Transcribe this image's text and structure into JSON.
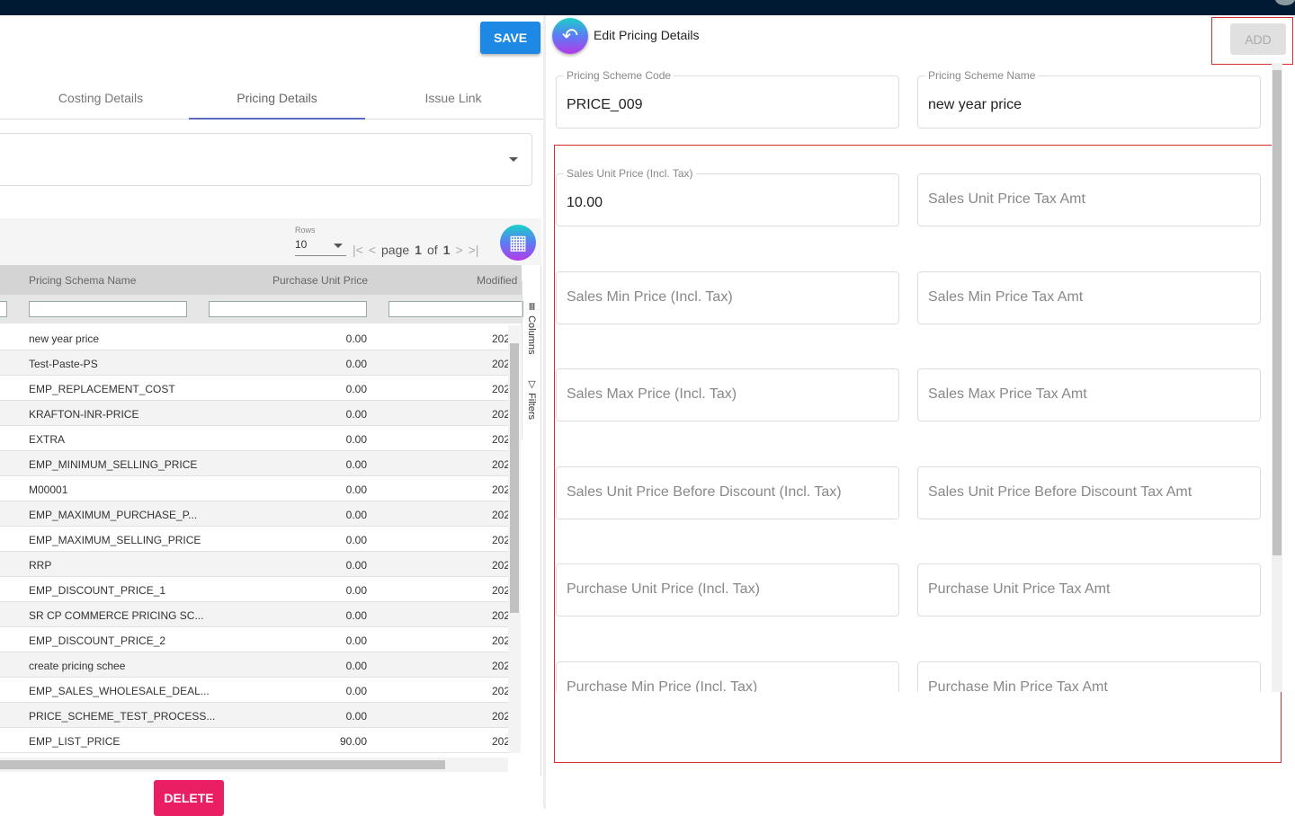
{
  "left": {
    "save_label": "SAVE",
    "delete_label": "DELETE",
    "tabs": [
      "Costing Details",
      "Pricing Details",
      "Issue Link"
    ],
    "pager": {
      "rows_label": "Rows",
      "rows_value": "10",
      "page_word": "page",
      "page": "1",
      "of_word": "of",
      "total": "1"
    },
    "columns": [
      "Pricing Schema Name",
      "Purchase Unit Price",
      "Modified"
    ],
    "side_tabs": [
      "Columns",
      "Filters"
    ],
    "rows": [
      [
        "new year price",
        "0.00",
        "202"
      ],
      [
        "Test-Paste-PS",
        "0.00",
        "202"
      ],
      [
        "EMP_REPLACEMENT_COST",
        "0.00",
        "202"
      ],
      [
        "KRAFTON-INR-PRICE",
        "0.00",
        "202"
      ],
      [
        "EXTRA",
        "0.00",
        "202"
      ],
      [
        "EMP_MINIMUM_SELLING_PRICE",
        "0.00",
        "202"
      ],
      [
        "M00001",
        "0.00",
        "202"
      ],
      [
        "EMP_MAXIMUM_PURCHASE_P...",
        "0.00",
        "202"
      ],
      [
        "EMP_MAXIMUM_SELLING_PRICE",
        "0.00",
        "202"
      ],
      [
        "RRP",
        "0.00",
        "202"
      ],
      [
        "EMP_DISCOUNT_PRICE_1",
        "0.00",
        "202"
      ],
      [
        "SR CP COMMERCE PRICING SC...",
        "0.00",
        "202"
      ],
      [
        "EMP_DISCOUNT_PRICE_2",
        "0.00",
        "202"
      ],
      [
        "create pricing schee",
        "0.00",
        "202"
      ],
      [
        "EMP_SALES_WHOLESALE_DEAL...",
        "0.00",
        "202"
      ],
      [
        "PRICE_SCHEME_TEST_PROCESS...",
        "0.00",
        "202"
      ],
      [
        "EMP_LIST_PRICE",
        "90.00",
        "202"
      ]
    ]
  },
  "right": {
    "title": "Edit Pricing Details",
    "add_label": "ADD",
    "code": {
      "label": "Pricing Scheme Code",
      "value": "PRICE_009"
    },
    "name": {
      "label": "Pricing Scheme Name",
      "value": "new year price"
    },
    "sales_unit_price": {
      "label": "Sales Unit Price (Incl. Tax)",
      "value": "10.00"
    },
    "placeholders": [
      "Sales Unit Price Tax Amt",
      "Sales Min Price (Incl. Tax)",
      "Sales Min Price Tax Amt",
      "Sales Max Price (Incl. Tax)",
      "Sales Max Price Tax Amt",
      "Sales Unit Price Before Discount (Incl. Tax)",
      "Sales Unit Price Before Discount Tax Amt",
      "Purchase Unit Price (Incl. Tax)",
      "Purchase Unit Price Tax Amt",
      "Purchase Min Price (Incl. Tax)",
      "Purchase Min Price Tax Amt"
    ]
  }
}
